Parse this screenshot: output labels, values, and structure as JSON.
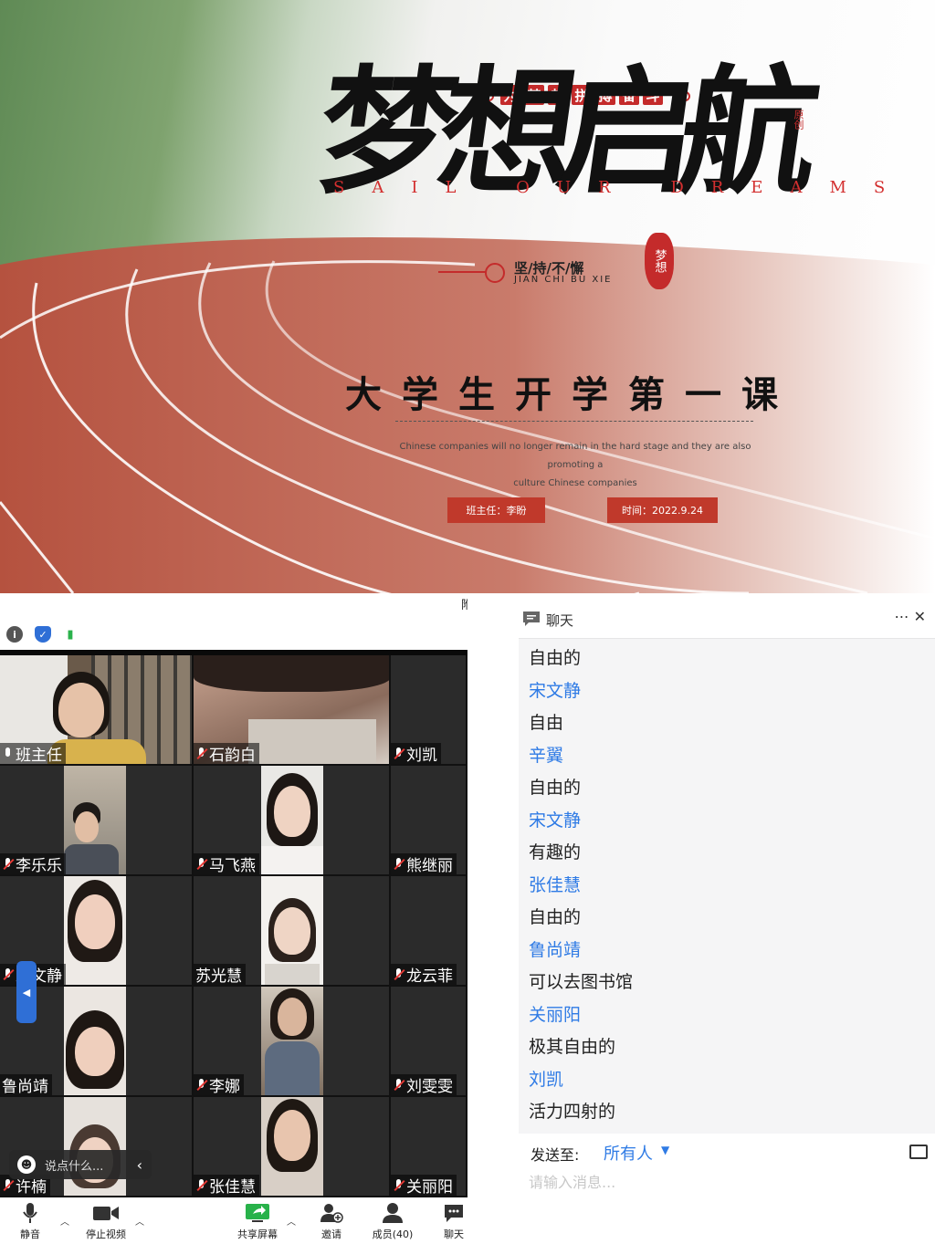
{
  "slide": {
    "tag_chars": [
      "为",
      "梦",
      "想",
      "拼",
      "搏",
      "奋",
      "斗"
    ],
    "main_title": "梦想启航",
    "english": "SAIL OUR DREAMS",
    "sub_cn": "坚/持/不/懈",
    "sub_pinyin": "JIAN CHI BU XIE",
    "seal_text": "梦想",
    "seal_small": "原创",
    "title": "大学生开学第一课",
    "desc_line1": "Chinese companies will no longer remain in the hard stage and they are also promoting a",
    "desc_line2": "culture Chinese companies",
    "teacher_box": "班主任：李盼",
    "date_box": "时间：2022.9.24",
    "accent": "#c0392b"
  },
  "meeting": {
    "top_clip_char": "附",
    "participants": [
      {
        "name": "班主任",
        "mic": "on"
      },
      {
        "name": "石韵白",
        "mic": "off"
      },
      {
        "name": "刘凯",
        "mic": "off"
      },
      {
        "name": "李乐乐",
        "mic": "off"
      },
      {
        "name": "马飞燕",
        "mic": "off"
      },
      {
        "name": "熊继丽",
        "mic": "off"
      },
      {
        "name": "宋文静",
        "mic": "off"
      },
      {
        "name": "苏光慧",
        "mic": "none"
      },
      {
        "name": "龙云菲",
        "mic": "off"
      },
      {
        "name": "鲁尚靖",
        "mic": "none"
      },
      {
        "name": "李娜",
        "mic": "off"
      },
      {
        "name": "刘雯雯",
        "mic": "off"
      },
      {
        "name": "许楠",
        "mic": "off"
      },
      {
        "name": "张佳慧",
        "mic": "off"
      },
      {
        "name": "关丽阳",
        "mic": "off"
      }
    ],
    "quick_chat_placeholder": "说点什么...",
    "toolbar": {
      "mute": "静音",
      "stop_video": "停止视频",
      "share": "共享屏幕",
      "invite": "邀请",
      "members": "成员(40)",
      "chat": "聊天"
    }
  },
  "chat": {
    "title": "聊天",
    "messages": [
      {
        "text": "自由的",
        "type": "msg"
      },
      {
        "text": "宋文静",
        "type": "sender"
      },
      {
        "text": "自由",
        "type": "msg"
      },
      {
        "text": "辛翼",
        "type": "sender"
      },
      {
        "text": "自由的",
        "type": "msg"
      },
      {
        "text": "宋文静",
        "type": "sender"
      },
      {
        "text": "有趣的",
        "type": "msg"
      },
      {
        "text": "张佳慧",
        "type": "sender"
      },
      {
        "text": "自由的",
        "type": "msg"
      },
      {
        "text": "鲁尚靖",
        "type": "sender"
      },
      {
        "text": "可以去图书馆",
        "type": "msg"
      },
      {
        "text": "关丽阳",
        "type": "sender"
      },
      {
        "text": "极其自由的",
        "type": "msg"
      },
      {
        "text": "刘凯",
        "type": "sender"
      },
      {
        "text": "活力四射的",
        "type": "msg"
      }
    ],
    "send_to_label": "发送至:",
    "send_to_target": "所有人",
    "input_placeholder": "请输入消息...",
    "sender_color": "#2f7be5"
  }
}
